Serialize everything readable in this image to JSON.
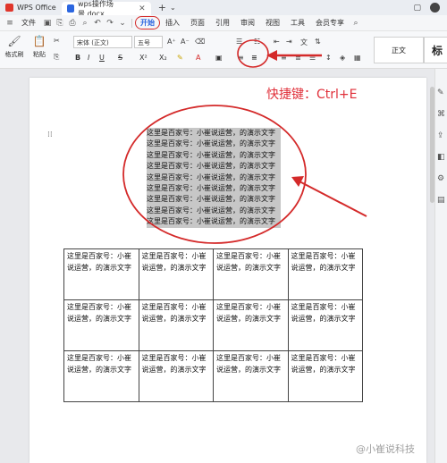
{
  "titlebar": {
    "app_name": "WPS Office",
    "doc_tab_title": "wps操作场景.docx",
    "close_glyph": "✕",
    "plus_glyph": "+",
    "chevron_glyph": "⌄"
  },
  "menubar": {
    "file_label": "文件",
    "items": [
      "开始",
      "插入",
      "页面",
      "引用",
      "审阅",
      "视图",
      "工具",
      "会员专享"
    ],
    "active_item": "开始",
    "active_circle_color": "#d42a2a"
  },
  "ribbon": {
    "format_painter_label": "格式刷",
    "paste_label": "粘贴",
    "font_name": "宋体 (正文)",
    "font_size": "五号",
    "bold": "B",
    "italic": "I",
    "underline": "U",
    "strike": "S",
    "superscript": "X²",
    "subscript": "X₂",
    "style_normal": "正文",
    "style_heading": "标",
    "highlighted_button": "align-center-button"
  },
  "annotation": {
    "shortcut_text": "快捷键：Ctrl+E",
    "color": "#e0303a"
  },
  "document": {
    "selected_lines": [
      "这里是百家号：小崔说运营，的演示文字",
      "这里是百家号：小崔说运营，的演示文字",
      "这里是百家号：小崔说运营，的演示文字",
      "这里是百家号：小崔说运营，的演示文字",
      "这里是百家号：小崔说运营，的演示文字",
      "这里是百家号：小崔说运营，的演示文字",
      "这里是百家号：小崔说运营，的演示文字",
      "这里是百家号：小崔说运营，的演示文字",
      "这里是百家号：小崔说运营，的演示文字"
    ],
    "table_cell_text": "这里是百家号：小崔说运营，的演示文字",
    "table_rows": 3,
    "table_cols": 4
  },
  "watermark": "@小崔说科技"
}
